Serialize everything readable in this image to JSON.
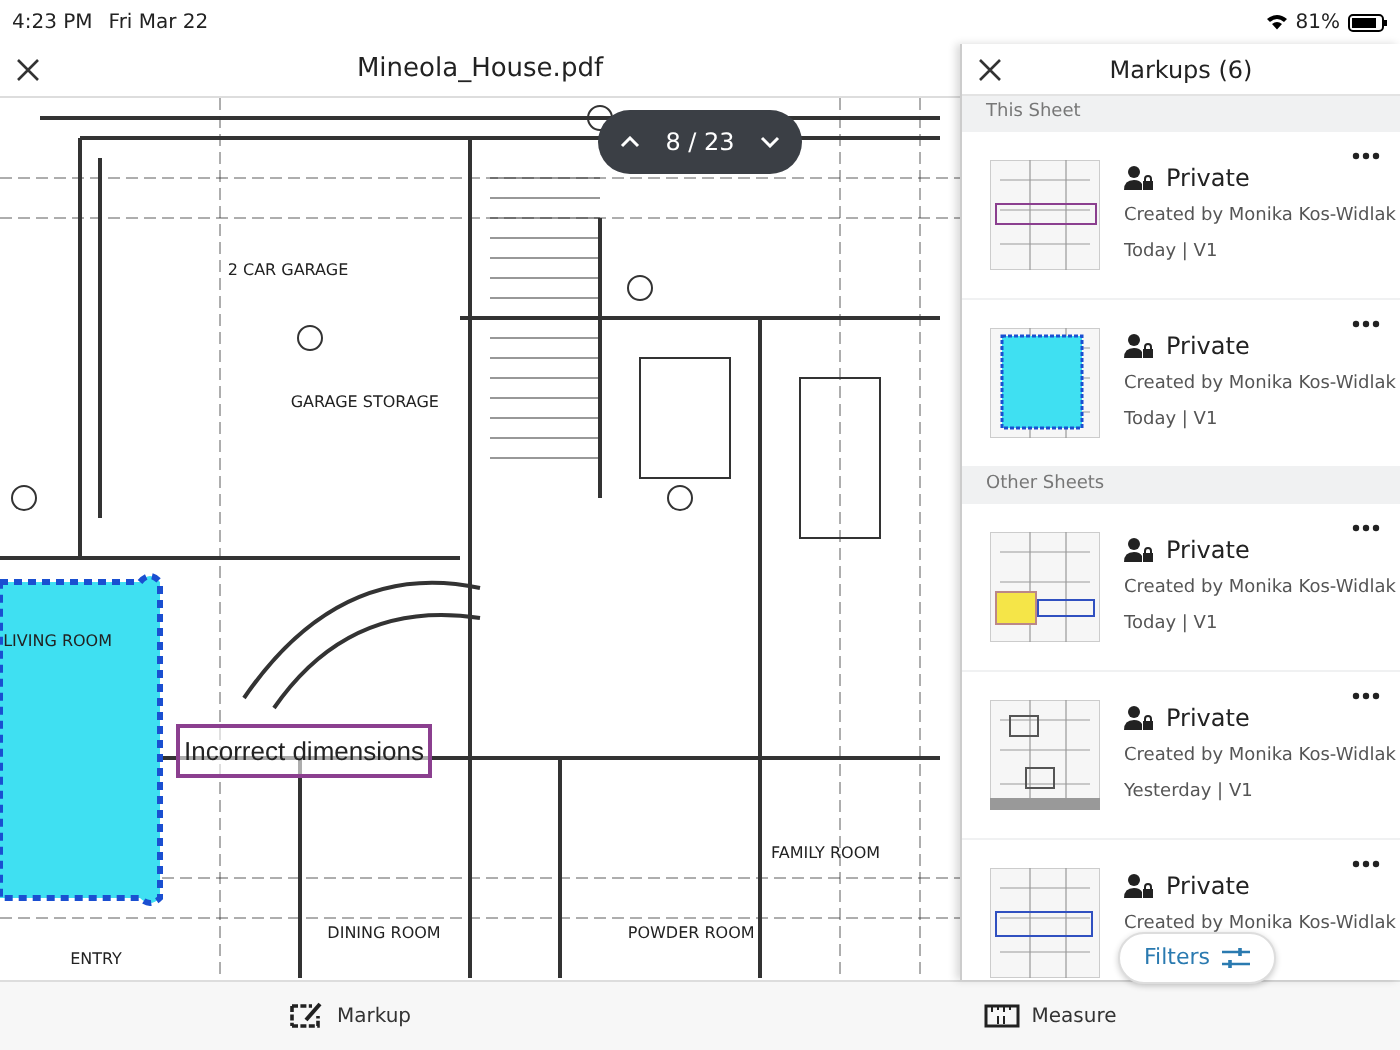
{
  "status_bar": {
    "time": "4:23 PM",
    "date": "Fri Mar 22",
    "battery": "81%"
  },
  "viewer": {
    "title": "Mineola_House.pdf",
    "page_indicator": "8 / 23",
    "markup_label": "Incorrect dimensions",
    "room_labels": [
      "2 CAR GARAGE",
      "GARAGE STORAGE",
      "LIVING ROOM",
      "FAMILY ROOM",
      "DINING ROOM",
      "POWDER ROOM",
      "ENTRY"
    ]
  },
  "panel": {
    "title": "Markups (6)",
    "sections": [
      {
        "heading": "This Sheet",
        "items": [
          {
            "kind": "textbox",
            "visibility": "Private",
            "author": "Created by Monika Kos-Widlak",
            "date": "Today | V1"
          },
          {
            "kind": "cloud",
            "visibility": "Private",
            "author": "Created by Monika Kos-Widlak",
            "date": "Today | V1"
          }
        ]
      },
      {
        "heading": "Other Sheets",
        "items": [
          {
            "kind": "highlight",
            "visibility": "Private",
            "author": "Created by Monika Kos-Widlak",
            "date": "Today | V1"
          },
          {
            "kind": "plan",
            "visibility": "Private",
            "author": "Created by Monika Kos-Widlak",
            "date": "Yesterday | V1"
          },
          {
            "kind": "bluebox",
            "visibility": "Private",
            "author": "Created by Monika Kos-Widlak"
          }
        ]
      }
    ],
    "filters_button": "Filters"
  },
  "toolbar": [
    {
      "kind": "markup",
      "label": "Markup"
    },
    {
      "kind": "measure",
      "label": "Measure"
    }
  ]
}
